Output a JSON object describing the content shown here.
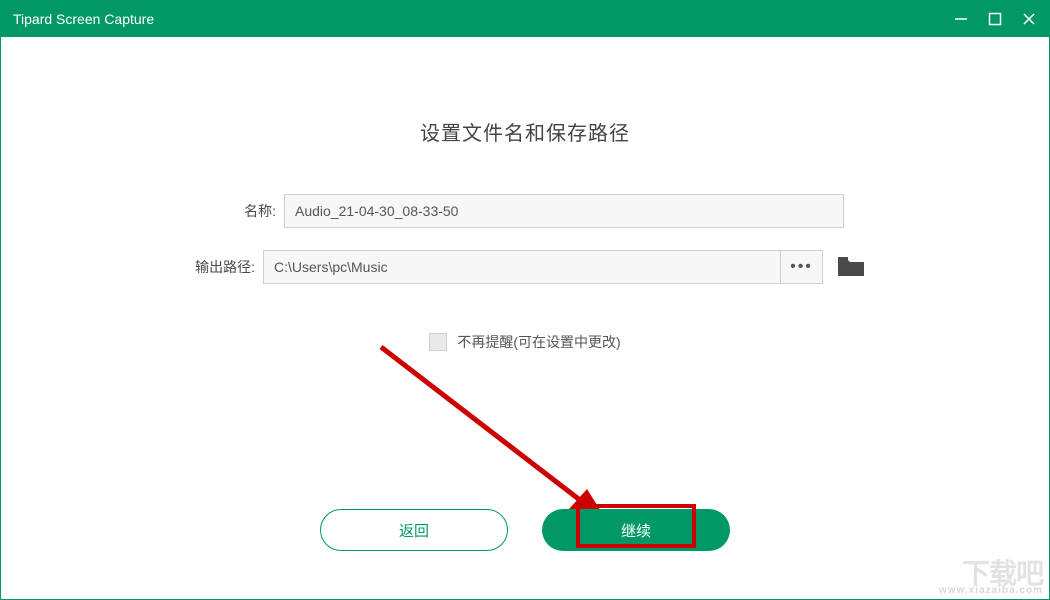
{
  "window": {
    "title": "Tipard Screen Capture"
  },
  "dialog": {
    "heading": "设置文件名和保存路径",
    "name_label": "名称:",
    "name_value": "Audio_21-04-30_08-33-50",
    "path_label": "输出路径:",
    "path_value": "C:\\Users\\pc\\Music",
    "more_symbol": "•••",
    "dont_remind_label": "不再提醒(可在设置中更改)",
    "back_label": "返回",
    "continue_label": "继续"
  },
  "watermark": {
    "text": "下载吧",
    "url": "www.xiazaiba.com"
  },
  "colors": {
    "accent": "#009966",
    "highlight": "#cc0000"
  }
}
